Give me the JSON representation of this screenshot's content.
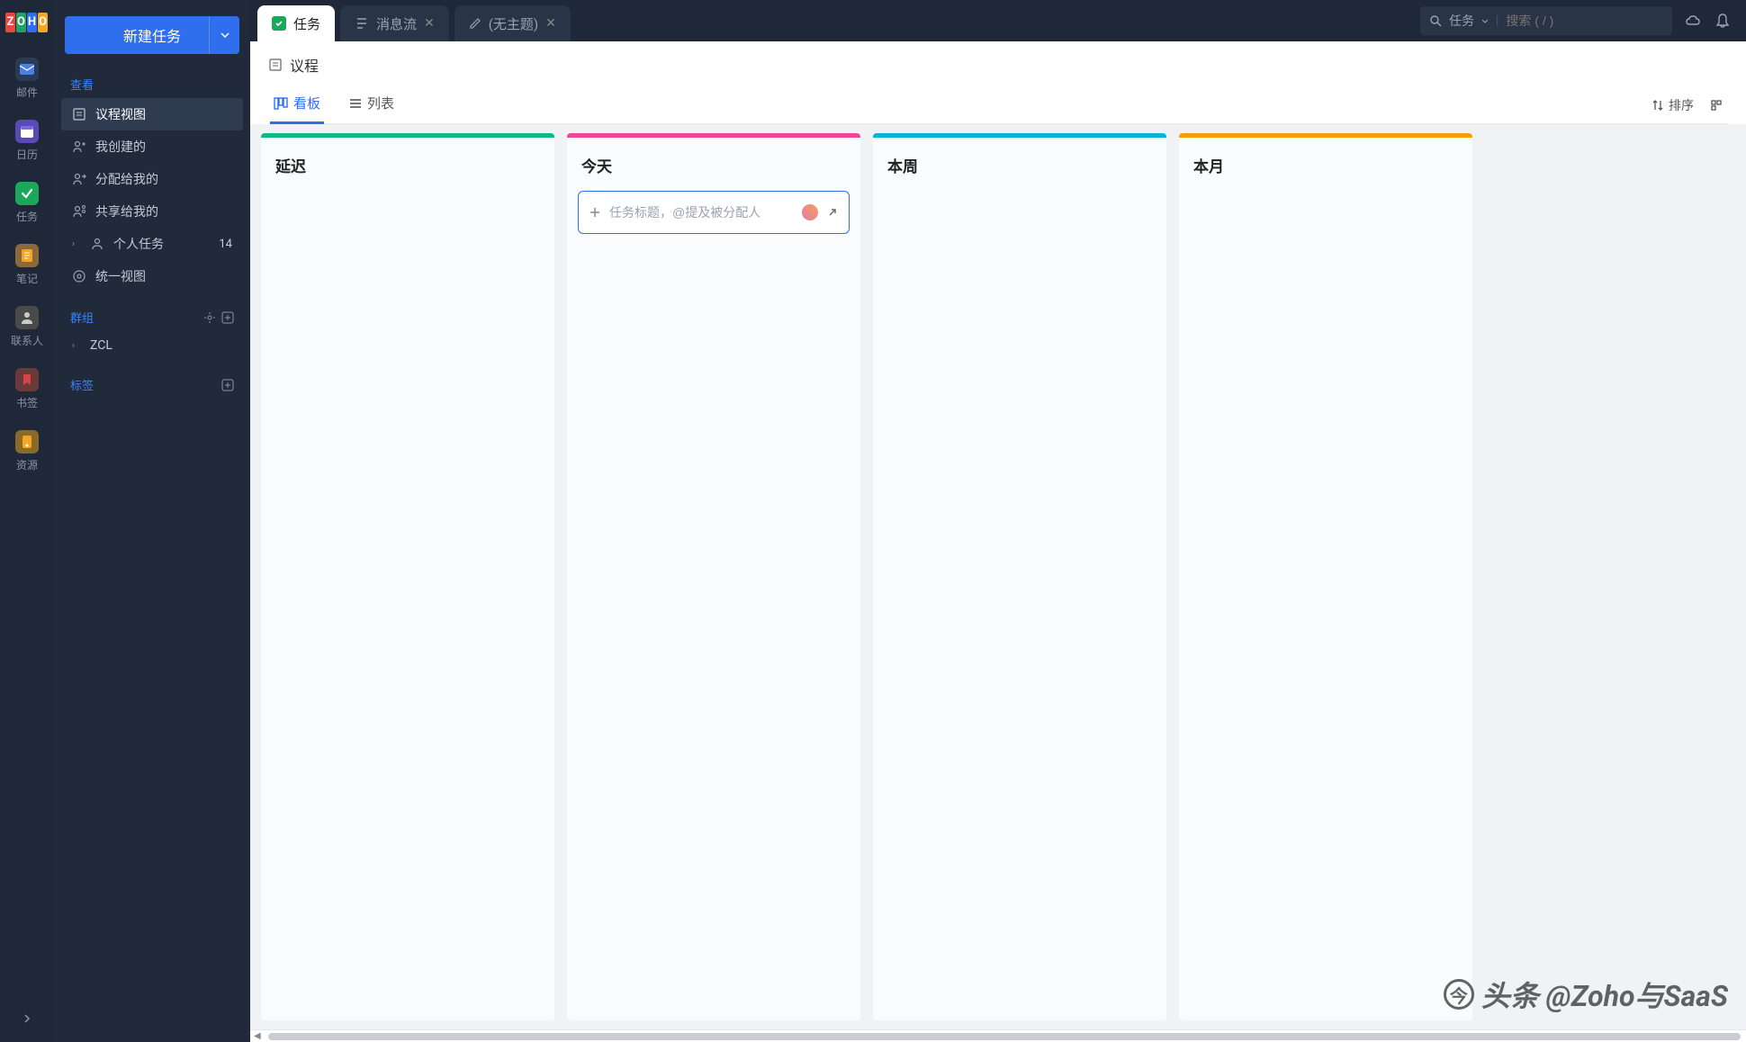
{
  "logo": {
    "z": "Z",
    "o1": "O",
    "h": "H",
    "o2": "O"
  },
  "rail": {
    "mail": "邮件",
    "calendar": "日历",
    "tasks": "任务",
    "notes": "笔记",
    "contacts": "联系人",
    "bookmarks": "书签",
    "resources": "资源"
  },
  "sidebar": {
    "new_task": "新建任务",
    "section_view": "查看",
    "items": {
      "agenda": "议程视图",
      "created_by_me": "我创建的",
      "assigned_to_me": "分配给我的",
      "shared_with_me": "共享给我的",
      "personal": "个人任务",
      "personal_count": "14",
      "unified": "统一视图"
    },
    "section_group": "群组",
    "group_item": "ZCL",
    "section_tags": "标签"
  },
  "tabs": {
    "tasks": "任务",
    "stream": "消息流",
    "untitled": "(无主题)"
  },
  "search": {
    "scope": "任务",
    "placeholder": "搜索 ( / )"
  },
  "page": {
    "title": "议程",
    "view_board": "看板",
    "view_list": "列表",
    "sort": "排序"
  },
  "board": {
    "cols": {
      "overdue": {
        "title": "延迟",
        "color": "#10b981"
      },
      "today": {
        "title": "今天",
        "color": "#ec4899"
      },
      "week": {
        "title": "本周",
        "color": "#06b6d4"
      },
      "month": {
        "title": "本月",
        "color": "#f59e0b"
      }
    },
    "input_placeholder": "任务标题，@提及被分配人"
  },
  "watermark": "头条 @Zoho与SaaS"
}
